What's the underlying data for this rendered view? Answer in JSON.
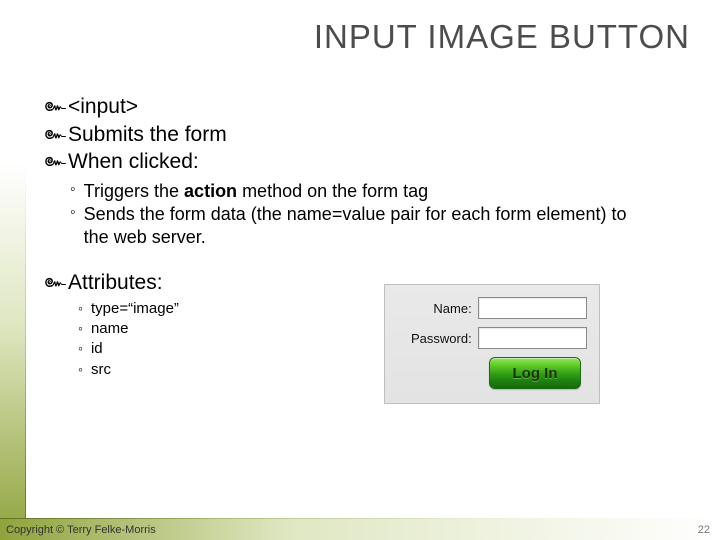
{
  "title": "INPUT IMAGE BUTTON",
  "bullets": {
    "b1": "<input>",
    "b2": "Submits the form",
    "b3": "When clicked:"
  },
  "clicked": {
    "c1_pre": "Triggers the ",
    "c1_strong": "action",
    "c1_post": " method on the form tag",
    "c2": "Sends the form data (the name=value pair for each form element) to the web server."
  },
  "attributes_label": "Attributes:",
  "attributes": {
    "a1": "type=“image”",
    "a2": "name",
    "a3": "id",
    "a4": "src"
  },
  "form": {
    "name_label": "Name:",
    "password_label": "Password:",
    "login_button": "Log In"
  },
  "footer": {
    "copyright": "Copyright © Terry Felke-Morris",
    "slide_number": "22"
  }
}
